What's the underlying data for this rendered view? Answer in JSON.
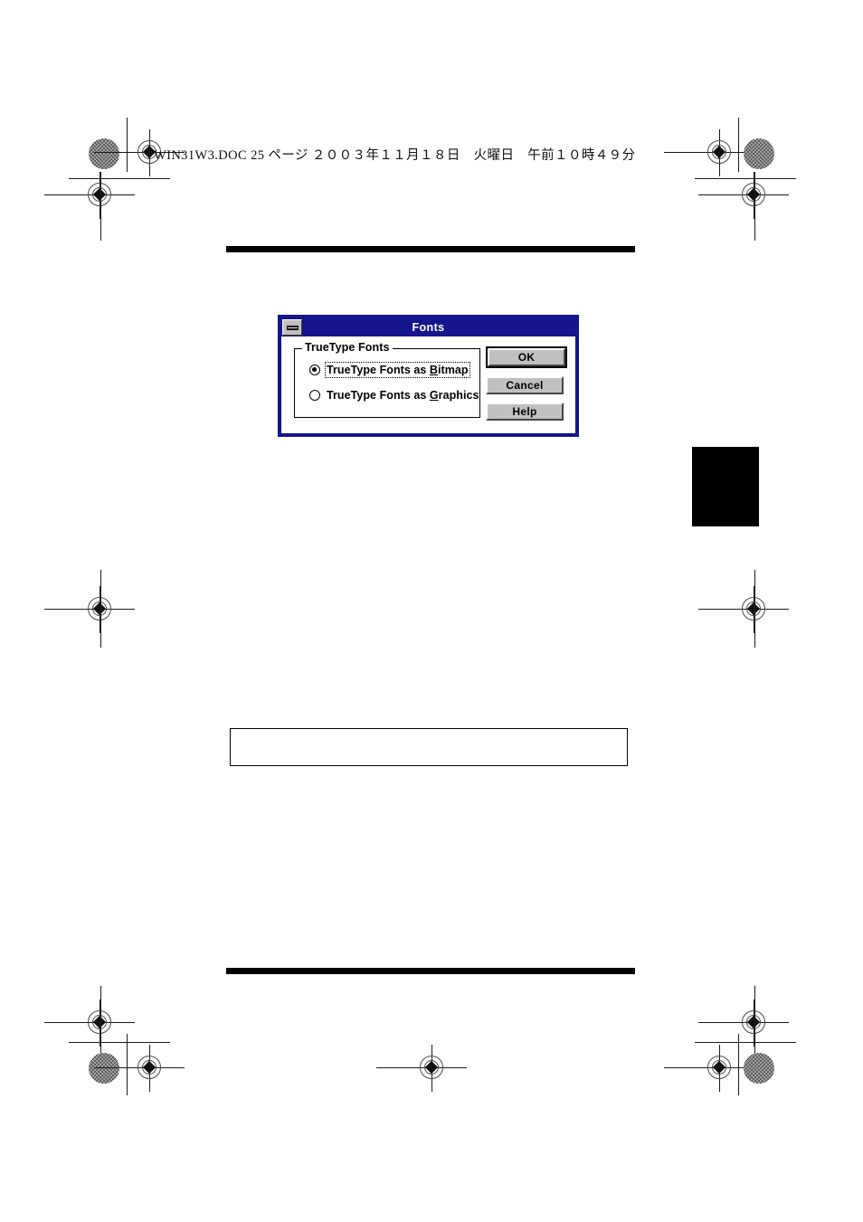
{
  "page": {
    "header_line": "WIN31W3.DOC   25 ページ   ２００３年１１月１８日　火曜日　午前１０時４９分",
    "background_color": "#ffffff",
    "rule_color": "#000000",
    "tab_marker_color": "#000000"
  },
  "dialog": {
    "title": "Fonts",
    "titlebar_color": "#15158c",
    "title_text_color": "#ffffff",
    "body_color": "#ffffff",
    "sysmenu_icon": "minimize-bar-icon",
    "group": {
      "label": "TrueType Fonts",
      "options": [
        {
          "label_before": "TrueType Fonts as ",
          "accel": "B",
          "label_after": "itmap",
          "full_label": "TrueType Fonts as Bitmap",
          "selected": true,
          "focused": true
        },
        {
          "label_before": "TrueType Fonts as ",
          "accel": "G",
          "label_after": "raphics",
          "full_label": "TrueType Fonts as Graphics",
          "selected": false,
          "focused": false
        }
      ]
    },
    "buttons": [
      {
        "label": "OK",
        "default": true
      },
      {
        "label": "Cancel",
        "default": false
      },
      {
        "label": "Help",
        "default": false
      }
    ]
  },
  "caption_box": {
    "text": ""
  }
}
